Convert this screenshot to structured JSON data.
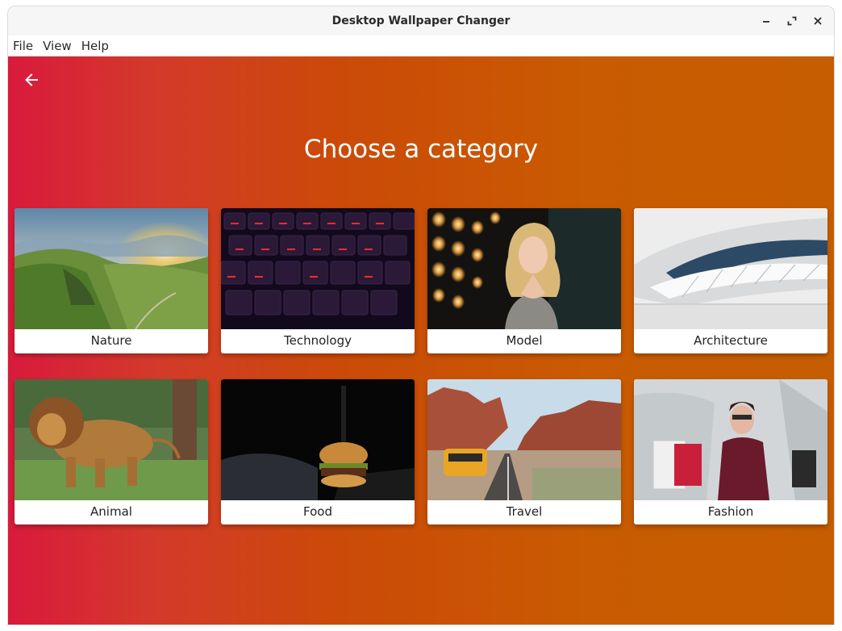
{
  "window": {
    "title": "Desktop Wallpaper Changer",
    "controls": [
      "minimize-icon",
      "maximize-icon",
      "close-icon"
    ]
  },
  "menu": {
    "items": [
      {
        "label": "File"
      },
      {
        "label": "View"
      },
      {
        "label": "Help"
      }
    ]
  },
  "page": {
    "back_icon": "arrow-left-icon",
    "heading": "Choose a category",
    "gradient": [
      "#d91a3c",
      "#c65d00"
    ]
  },
  "categories": [
    {
      "label": "Nature"
    },
    {
      "label": "Technology"
    },
    {
      "label": "Model"
    },
    {
      "label": "Architecture"
    },
    {
      "label": "Animal"
    },
    {
      "label": "Food"
    },
    {
      "label": "Travel"
    },
    {
      "label": "Fashion"
    }
  ]
}
